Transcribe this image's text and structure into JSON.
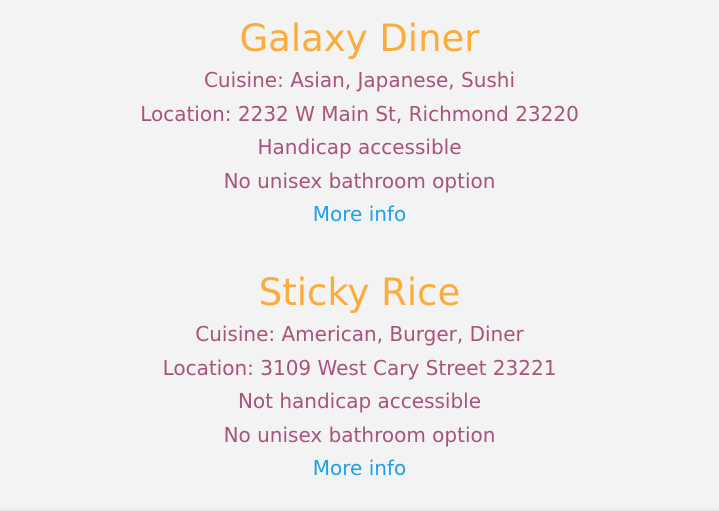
{
  "restaurants": [
    {
      "name": "Galaxy Diner",
      "cuisine": "Cuisine: Asian, Japanese, Sushi",
      "location": "Location: 2232 W Main St, Richmond 23220",
      "accessibility": "Handicap accessible",
      "bathroom": "No unisex bathroom option",
      "more_info": "More info"
    },
    {
      "name": "Sticky Rice",
      "cuisine": "Cuisine: American, Burger, Diner",
      "location": "Location: 3109 West Cary Street 23221",
      "accessibility": "Not handicap accessible",
      "bathroom": "No unisex bathroom option",
      "more_info": "More info"
    }
  ],
  "colors": {
    "name": "#fbac3a",
    "details": "#a8547e",
    "link": "#1ea1e6",
    "background": "#f3f3f3"
  }
}
